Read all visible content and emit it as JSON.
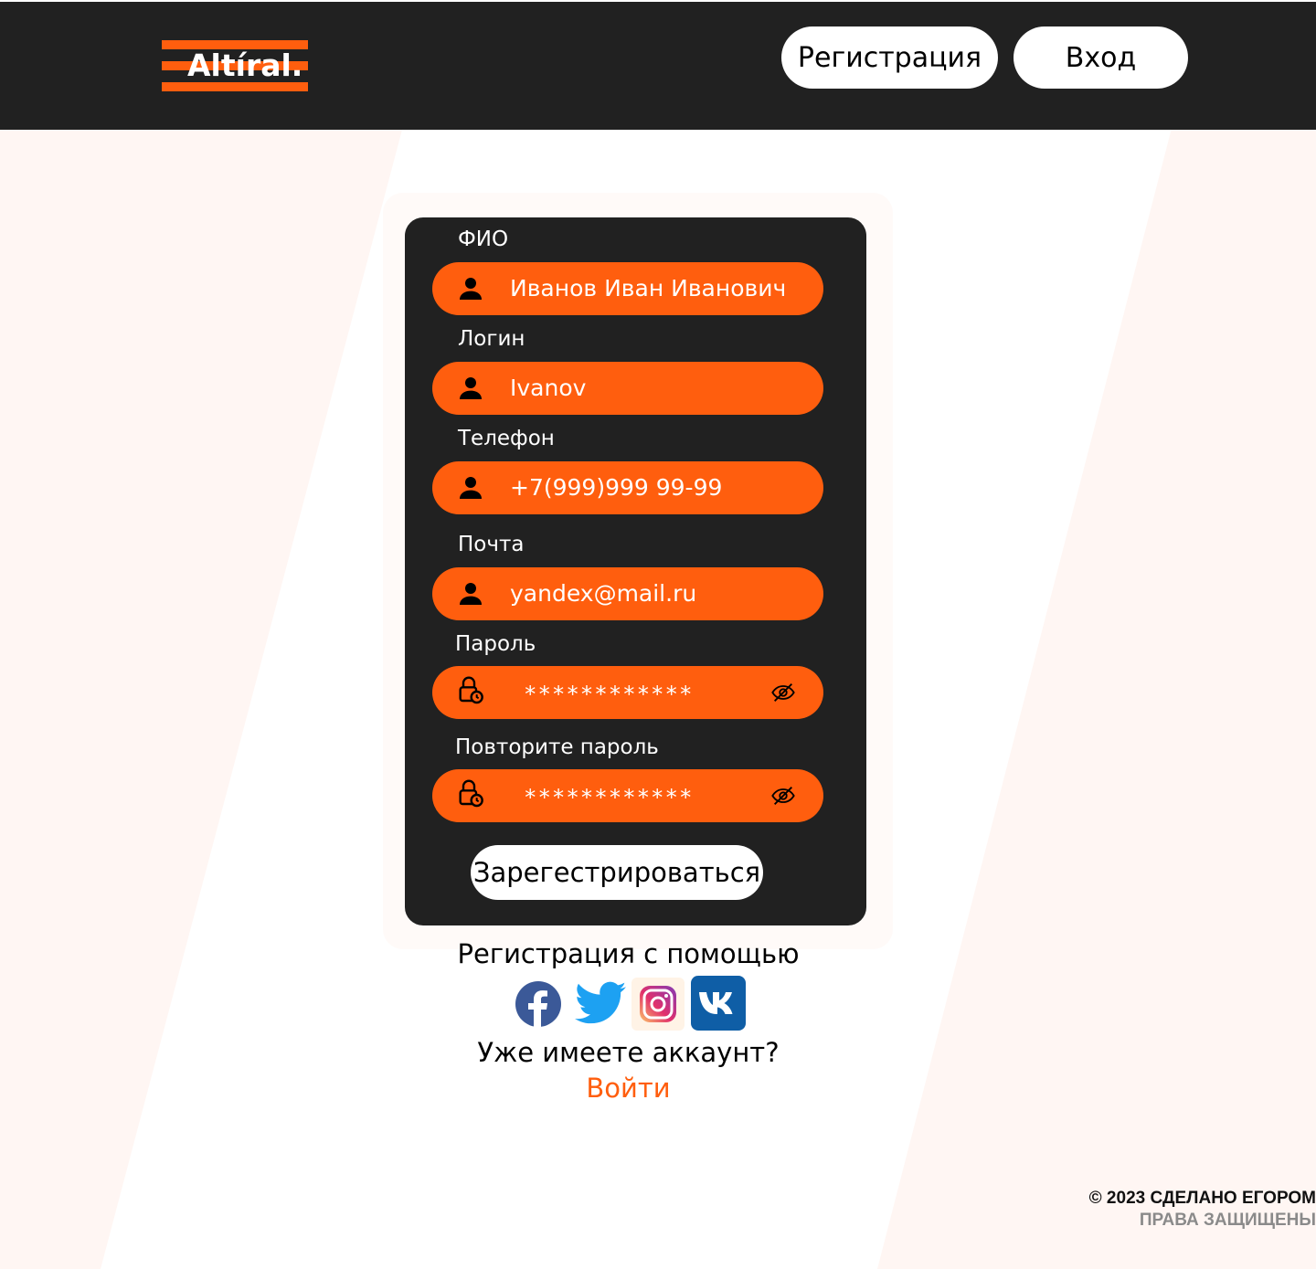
{
  "header": {
    "logo_text": "Altíral.",
    "register_label": "Регистрация",
    "login_label": "Вход"
  },
  "form": {
    "fields": [
      {
        "label": "ФИО",
        "value": "Иванов Иван Иванович",
        "icon": "user-icon"
      },
      {
        "label": "Логин",
        "value": "Ivanov",
        "icon": "user-icon"
      },
      {
        "label": "Телефон",
        "value": "+7(999)999 99-99",
        "icon": "user-icon"
      },
      {
        "label": "Почта",
        "value": "yandex@mail.ru",
        "icon": "user-icon"
      },
      {
        "label": "Пароль",
        "value": "************",
        "icon": "lock-icon",
        "toggle_icon": "eye-off-icon"
      },
      {
        "label": "Повторите пароль",
        "value": "************",
        "icon": "lock-icon",
        "toggle_icon": "eye-off-icon"
      }
    ],
    "submit_label": "Зарегестрироваться"
  },
  "social": {
    "heading": "Регистрация с помощью",
    "providers": [
      "facebook-icon",
      "twitter-icon",
      "instagram-icon",
      "vk-icon"
    ]
  },
  "account": {
    "question": "Уже имеете аккаунт?",
    "signin_link": "Войти"
  },
  "footer": {
    "copyright": "© 2023 СДЕЛАНО ЕГОРОМ",
    "rights": "ПРАВА ЗАЩИЩЕНЫ"
  },
  "colors": {
    "accent": "#ff5e0e",
    "dark": "#212121",
    "background_tint": "#fff6f3"
  }
}
